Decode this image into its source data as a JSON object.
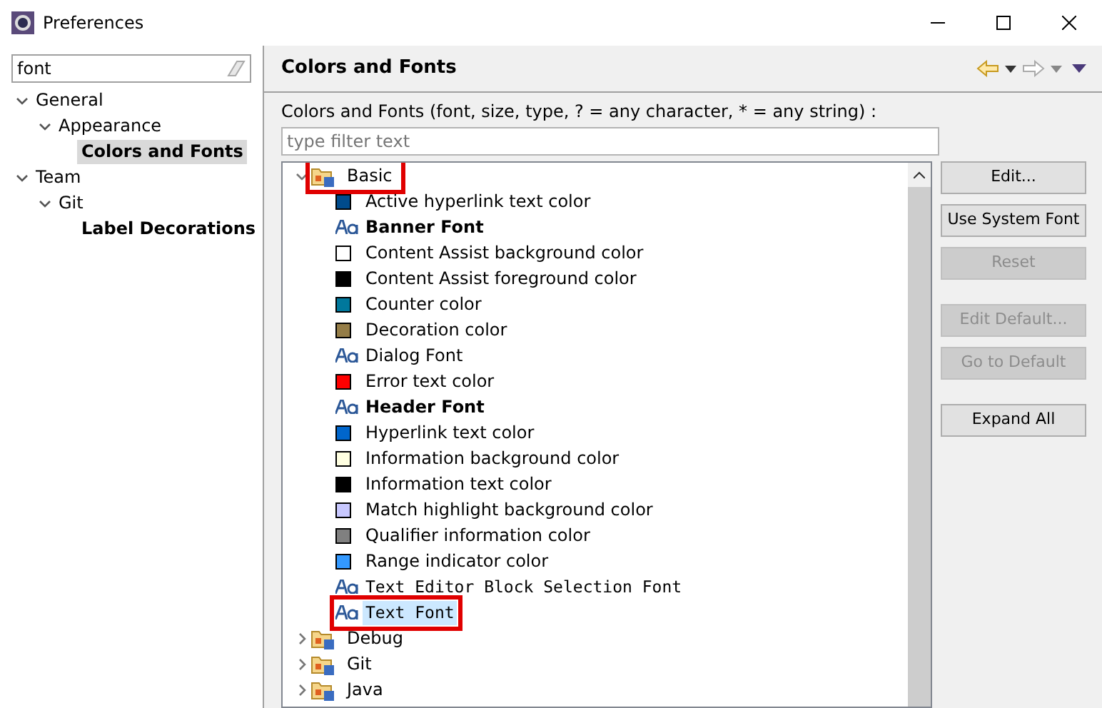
{
  "window": {
    "title": "Preferences"
  },
  "sidebar": {
    "filter_value": "font",
    "items": [
      {
        "label": "General",
        "expanded": true,
        "bold": false,
        "selected": false,
        "children": [
          {
            "label": "Appearance",
            "expanded": true,
            "bold": false,
            "selected": false,
            "children": [
              {
                "label": "Colors and Fonts",
                "bold": true,
                "selected": true
              }
            ]
          }
        ]
      },
      {
        "label": "Team",
        "expanded": true,
        "bold": false,
        "selected": false,
        "children": [
          {
            "label": "Git",
            "expanded": true,
            "bold": false,
            "selected": false,
            "children": [
              {
                "label": "Label Decorations",
                "bold": true,
                "selected": false
              }
            ]
          }
        ]
      }
    ]
  },
  "page": {
    "title": "Colors and Fonts",
    "description": "Colors and Fonts (font, size, type, ? = any character, * = any string) :",
    "filter_placeholder": "type filter text"
  },
  "tree": [
    {
      "label": "Basic",
      "expanded": true,
      "highlighted": true,
      "children": [
        {
          "kind": "color",
          "label": "Active hyperlink text color",
          "color": "#004b8c"
        },
        {
          "kind": "font",
          "label": "Banner Font",
          "bold": true
        },
        {
          "kind": "color",
          "label": "Content Assist background color",
          "color": "#ffffff"
        },
        {
          "kind": "color",
          "label": "Content Assist foreground color",
          "color": "#000000"
        },
        {
          "kind": "color",
          "label": "Counter color",
          "color": "#00789c"
        },
        {
          "kind": "color",
          "label": "Decoration color",
          "color": "#957d47"
        },
        {
          "kind": "font",
          "label": "Dialog Font",
          "bold": false
        },
        {
          "kind": "color",
          "label": "Error text color",
          "color": "#ff0000"
        },
        {
          "kind": "font",
          "label": "Header Font",
          "bold": true
        },
        {
          "kind": "color",
          "label": "Hyperlink text color",
          "color": "#0066cc"
        },
        {
          "kind": "color",
          "label": "Information background color",
          "color": "#ffffe1"
        },
        {
          "kind": "color",
          "label": "Information text color",
          "color": "#000000"
        },
        {
          "kind": "color",
          "label": "Match highlight background color",
          "color": "#c8c8ff"
        },
        {
          "kind": "color",
          "label": "Qualifier information color",
          "color": "#808080"
        },
        {
          "kind": "color",
          "label": "Range indicator color",
          "color": "#3399ff"
        },
        {
          "kind": "monofont",
          "label": "Text Editor Block Selection Font",
          "selected": false,
          "highlighted": false
        },
        {
          "kind": "monofont",
          "label": "Text Font",
          "selected": true,
          "highlighted": true
        }
      ]
    },
    {
      "label": "Debug",
      "expanded": false,
      "highlighted": false
    },
    {
      "label": "Git",
      "expanded": false,
      "highlighted": false
    },
    {
      "label": "Java",
      "expanded": false,
      "highlighted": false
    }
  ],
  "button_groups": [
    [
      {
        "label": "Edit...",
        "disabled": false
      },
      {
        "label": "Use System Font",
        "disabled": false
      },
      {
        "label": "Reset",
        "disabled": true
      }
    ],
    [
      {
        "label": "Edit Default...",
        "disabled": true
      },
      {
        "label": "Go to Default",
        "disabled": true
      }
    ],
    [
      {
        "label": "Expand All",
        "disabled": false
      }
    ]
  ]
}
